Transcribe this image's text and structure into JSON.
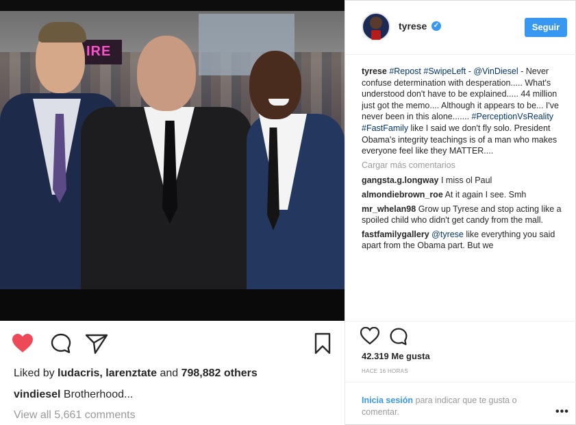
{
  "post": {
    "photo_alt": "",
    "actions": {
      "like_icon": "heart-filled-icon",
      "comment_icon": "comment-bubble-icon",
      "share_icon": "paper-plane-icon",
      "save_icon": "bookmark-icon"
    },
    "liked_by_prefix": "Liked by ",
    "liked_by_users": "ludacris, larenztate",
    "liked_by_and": " and ",
    "liked_by_others": "798,882 others",
    "caption_user": "vindiesel",
    "caption_text": " Brotherhood...",
    "view_all_comments": "View all 5,661 comments"
  },
  "panel": {
    "header": {
      "username": "tyrese",
      "verified_icon": "verified-check-icon",
      "follow_label": "Seguir"
    },
    "caption": {
      "user": "tyrese",
      "tag1": "#Repost",
      "tag2": "#SwipeLeft",
      "sep": " - ",
      "mention": "@VinDiesel",
      "text1": " - Never confuse determination with desperation..... What's understood don't have to be explained..... 44 million just got the memo.... Although it appears to be... I've never been in this alone.......",
      "tag3": "#PerceptionVsReality",
      "tag4": "#FastFamily",
      "text2": " like I said we don't fly solo. President Obama's integrity teachings is of a man who makes everyone feel like they MATTER...."
    },
    "load_more": "Cargar más comentarios",
    "comments": [
      {
        "user": "gangsta.g.longway",
        "text": " I miss ol Paul"
      },
      {
        "user": "almondiebrown_roe",
        "text": " At it again I see. Smh"
      },
      {
        "user": "mr_whelan98",
        "text": " Grow up Tyrese and stop acting like a spoiled child who didn't get candy from the mall."
      },
      {
        "user": "fastfamilygallery",
        "mention": "@tyrese",
        "text": " like everything you said apart from the Obama part. But we"
      }
    ],
    "likes": "42.319 Me gusta",
    "timestamp": "HACE 16 HORAS",
    "login_link": "Inicia sesión",
    "login_text": " para indicar que te gusta o comentar.",
    "more_icon": "more-dots-icon",
    "more_glyph": "•••"
  },
  "colors": {
    "like_red": "#ed4956",
    "link_blue": "#3897f0",
    "tag_blue": "#003569"
  }
}
